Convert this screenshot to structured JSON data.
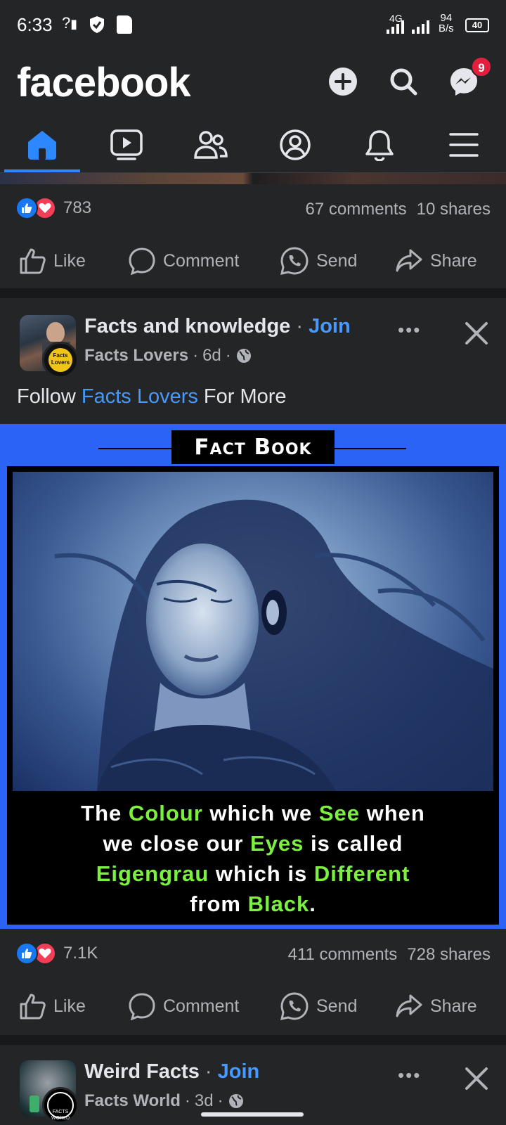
{
  "status_bar": {
    "time": "6:33",
    "network_label": "?",
    "signal_label": "4G",
    "speed_value": "94",
    "speed_unit": "B/s",
    "battery": "40"
  },
  "header": {
    "logo": "facebook",
    "messenger_badge": "9",
    "icons": [
      "plus-icon",
      "search-icon",
      "messenger-icon"
    ]
  },
  "nav": {
    "tabs": [
      "home",
      "watch",
      "friends",
      "profile",
      "notifications",
      "menu"
    ],
    "active": "home"
  },
  "posts": [
    {
      "reactions_count": "783",
      "comments": "67 comments",
      "shares": "10 shares",
      "actions": {
        "like": "Like",
        "comment": "Comment",
        "send": "Send",
        "share": "Share"
      }
    },
    {
      "group": "Facts and knowledge",
      "join": "Join",
      "author": "Facts Lovers",
      "age": "6d",
      "avatar_badge": "Facts Lovers",
      "caption_pre": "Follow ",
      "caption_link": "Facts Lovers",
      "caption_post": " For More",
      "image": {
        "title": "Fact Book",
        "text": {
          "w1": "The ",
          "w2": "Colour",
          "w3": " which we ",
          "w4": "See",
          "w5": " when",
          "w6": "we close our ",
          "w7": "Eyes",
          "w8": " is called",
          "w9": "Eigengrau",
          "w10": " which is ",
          "w11": "Different",
          "w12": "from ",
          "w13": "Black",
          "w14": "."
        }
      },
      "reactions_count": "7.1K",
      "comments": "411 comments",
      "shares": "728 shares",
      "actions": {
        "like": "Like",
        "comment": "Comment",
        "send": "Send",
        "share": "Share"
      }
    },
    {
      "group": "Weird Facts",
      "join": "Join",
      "author": "Facts World",
      "age": "3d",
      "avatar_badge": "FACTS WORLD"
    }
  ],
  "colors": {
    "background": "#242526",
    "divider": "#18191a",
    "accent": "#2d88ff",
    "link": "#4599ff",
    "fact_blue": "#2a63f5",
    "fact_green": "#7cf03f"
  }
}
